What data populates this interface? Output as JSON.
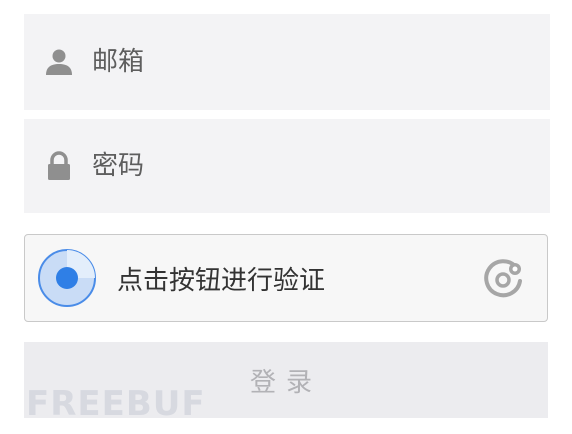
{
  "form": {
    "email": {
      "placeholder": "邮箱",
      "value": "",
      "icon": "user-icon"
    },
    "password": {
      "placeholder": "密码",
      "value": "",
      "icon": "lock-icon"
    },
    "captcha": {
      "label": "点击按钮进行验证",
      "icon": "radar-icon",
      "brand_icon": "geetest-logo-icon"
    },
    "login_label": "登录"
  },
  "watermark": "FREEBUF",
  "colors": {
    "field_bg": "#f3f3f5",
    "captcha_accent": "#2f7fe6",
    "button_bg": "#ececef",
    "button_text": "#b2b2b6"
  }
}
